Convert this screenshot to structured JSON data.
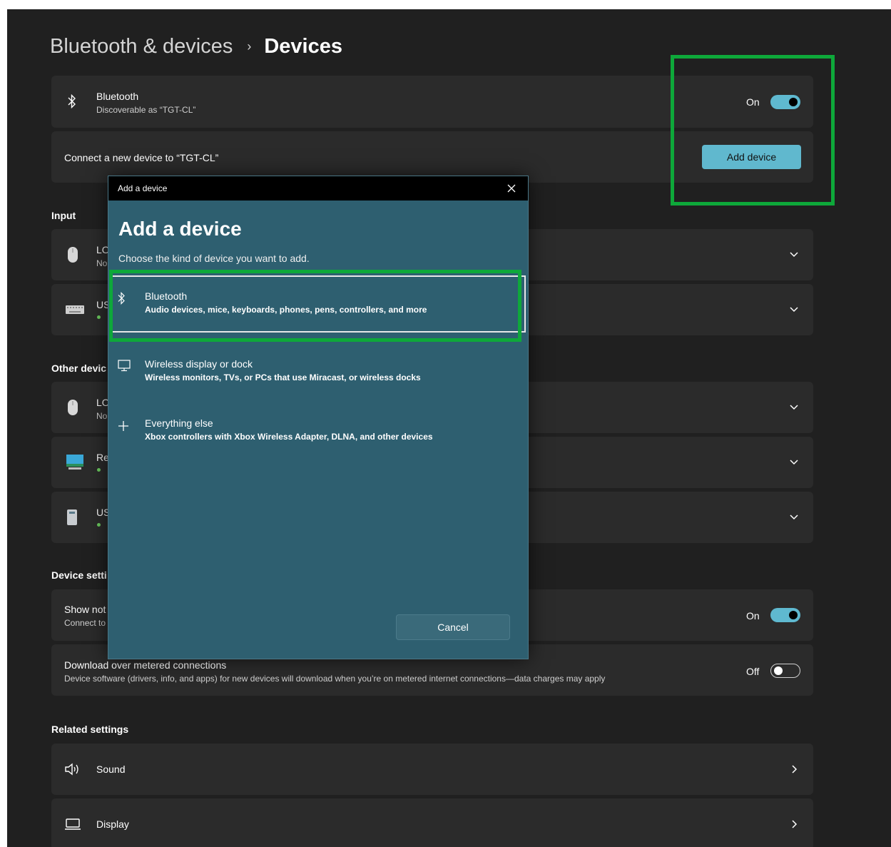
{
  "breadcrumb": {
    "parent": "Bluetooth & devices",
    "separator": "›",
    "current": "Devices"
  },
  "bluetooth": {
    "title": "Bluetooth",
    "subtitle": "Discoverable as “TGT-CL”",
    "state": "On"
  },
  "connect": {
    "label": "Connect a new device to “TGT-CL”",
    "button": "Add device"
  },
  "sections": {
    "input": "Input",
    "other": "Other devic",
    "device_settings": "Device setti",
    "related": "Related settings"
  },
  "input_devices": [
    {
      "name": "LO",
      "status": "No",
      "icon": "mouse-icon"
    },
    {
      "name": "US",
      "status": "",
      "icon": "keyboard-icon",
      "connected": true
    }
  ],
  "other_devices": [
    {
      "name": "LO",
      "status": "No",
      "icon": "mouse-icon"
    },
    {
      "name": "Re",
      "status": "",
      "icon": "monitor-icon",
      "connected": true
    },
    {
      "name": "US",
      "status": "",
      "icon": "drive-icon",
      "connected": true
    }
  ],
  "device_settings": [
    {
      "title": "Show not",
      "subtitle": "Connect to",
      "state": "On"
    },
    {
      "title": "Download over metered connections",
      "subtitle": "Device software (drivers, info, and apps) for new devices will download when you’re on metered internet connections—data charges may apply",
      "state": "Off"
    }
  ],
  "related": [
    {
      "label": "Sound",
      "icon": "speaker-icon"
    },
    {
      "label": "Display",
      "icon": "laptop-icon"
    }
  ],
  "dialog": {
    "window_title": "Add a device",
    "heading": "Add a device",
    "prompt": "Choose the kind of device you want to add.",
    "options": [
      {
        "title": "Bluetooth",
        "desc": "Audio devices, mice, keyboards, phones, pens, controllers, and more",
        "icon": "bluetooth-icon"
      },
      {
        "title": "Wireless display or dock",
        "desc": "Wireless monitors, TVs, or PCs that use Miracast, or wireless docks",
        "icon": "monitor-icon"
      },
      {
        "title": "Everything else",
        "desc": "Xbox controllers with Xbox Wireless Adapter, DLNA, and other devices",
        "icon": "plus-icon"
      }
    ],
    "cancel": "Cancel"
  },
  "colors": {
    "accent": "#60b8ce",
    "highlight": "#0ea83a",
    "dialog_bg": "#2e5f70",
    "page_bg": "#202020",
    "card_bg": "#2b2b2b"
  }
}
